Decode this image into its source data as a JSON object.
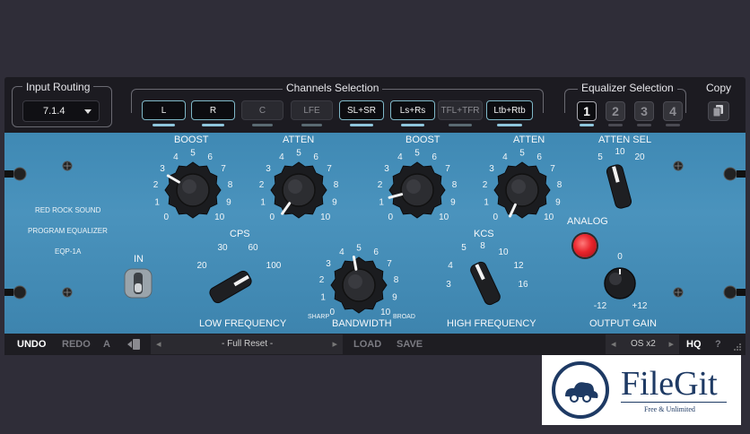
{
  "header": {
    "input_routing": {
      "label": "Input Routing",
      "value": "7.1.4"
    },
    "channels_selection": {
      "label": "Channels Selection",
      "buttons": [
        {
          "label": "L",
          "active": true
        },
        {
          "label": "R",
          "active": true
        },
        {
          "label": "C",
          "active": false
        },
        {
          "label": "LFE",
          "active": false
        },
        {
          "label": "SL+SR",
          "active": true
        },
        {
          "label": "Ls+Rs",
          "active": true
        },
        {
          "label": "TFL+TFR",
          "active": false
        },
        {
          "label": "Ltb+Rtb",
          "active": true
        }
      ]
    },
    "equalizer_selection": {
      "label": "Equalizer Selection",
      "buttons": [
        "1",
        "2",
        "3",
        "4"
      ],
      "selected": "1"
    },
    "copy": {
      "label": "Copy"
    }
  },
  "panel": {
    "brand": [
      "RED ROCK SOUND",
      "PROGRAM EQUALIZER",
      "EQP-1A"
    ],
    "in_switch": {
      "label": "IN"
    },
    "knobs": {
      "boost1": {
        "title": "BOOST",
        "scale": [
          "0",
          "1",
          "2",
          "3",
          "4",
          "5",
          "6",
          "7",
          "8",
          "9",
          "10"
        ]
      },
      "atten1": {
        "title": "ATTEN",
        "scale": [
          "0",
          "1",
          "2",
          "3",
          "4",
          "5",
          "6",
          "7",
          "8",
          "9",
          "10"
        ]
      },
      "boost2": {
        "title": "BOOST",
        "scale": [
          "0",
          "1",
          "2",
          "3",
          "4",
          "5",
          "6",
          "7",
          "8",
          "9",
          "10"
        ]
      },
      "atten2": {
        "title": "ATTEN",
        "scale": [
          "0",
          "1",
          "2",
          "3",
          "4",
          "5",
          "6",
          "7",
          "8",
          "9",
          "10"
        ]
      },
      "atten_sel": {
        "title": "ATTEN SEL",
        "scale": [
          "5",
          "10",
          "20"
        ]
      },
      "low_frequency": {
        "title": "LOW FREQUENCY",
        "unit": "CPS",
        "scale": [
          "20",
          "30",
          "60",
          "100"
        ]
      },
      "bandwidth": {
        "title": "BANDWIDTH",
        "scale": [
          "0",
          "1",
          "2",
          "3",
          "4",
          "5",
          "6",
          "7",
          "8",
          "9",
          "10"
        ],
        "left": "SHARP",
        "right": "BROAD"
      },
      "high_frequency": {
        "title": "HIGH FREQUENCY",
        "unit": "KCS",
        "scale": [
          "3",
          "4",
          "5",
          "8",
          "10",
          "12",
          "16"
        ]
      },
      "output_gain": {
        "title": "OUTPUT GAIN",
        "scale": [
          "-12",
          "0",
          "+12"
        ]
      }
    },
    "analog": {
      "label": "ANALOG",
      "led_color": "#e8242c"
    }
  },
  "footer": {
    "undo": "UNDO",
    "redo": "REDO",
    "a_b": "A",
    "preset": "- Full Reset -",
    "load": "LOAD",
    "save": "SAVE",
    "os": "OS x2",
    "hq": "HQ",
    "help": "?"
  },
  "watermark": {
    "name": "FileGit",
    "tagline": "Free & Unlimited"
  },
  "colors": {
    "panel_blue": "#428cb7",
    "led_red": "#e8242c",
    "accent_cyan": "#8fc6dc"
  }
}
